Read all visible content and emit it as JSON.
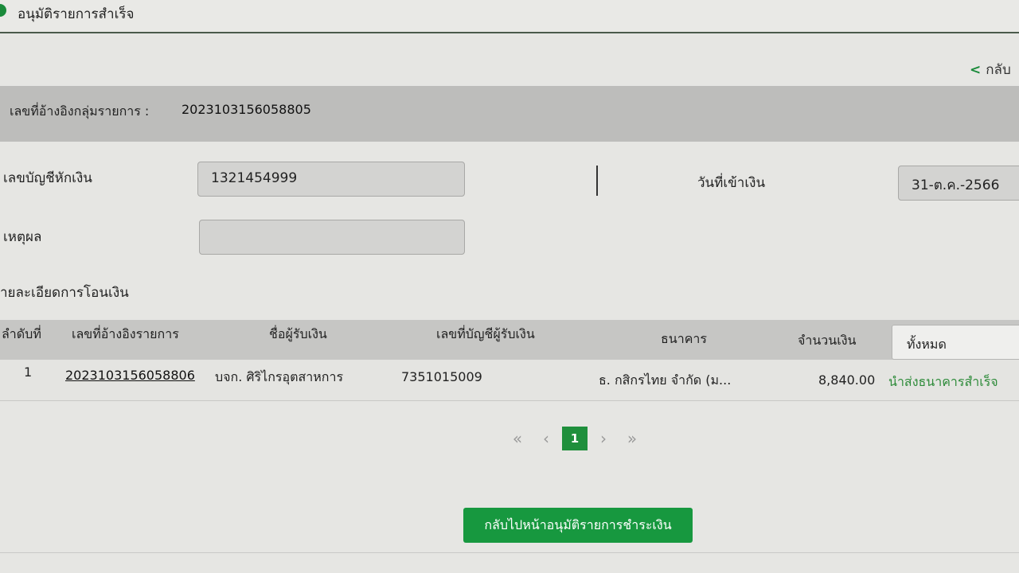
{
  "header": {
    "title": "อนุมัติรายการสำเร็จ"
  },
  "back_link": {
    "label": "กลับ"
  },
  "group_ref": {
    "label": "เลขที่อ้างอิงกลุ่มรายการ :",
    "value": "2023103156058805"
  },
  "form": {
    "debit_account": {
      "label": "เลขบัญชีหักเงิน",
      "value": "1321454999"
    },
    "credit_date": {
      "label": "วันที่เข้าเงิน",
      "value": "31-ต.ค.-2566"
    },
    "reason": {
      "label": "เหตุผล",
      "value": ""
    }
  },
  "section": {
    "title": "ายละเอียดการโอนเงิน"
  },
  "table": {
    "columns": [
      "ลำดับที่",
      "เลขที่อ้างอิงรายการ",
      "ชื่อผู้รับเงิน",
      "เลขที่บัญชีผู้รับเงิน",
      "ธนาคาร",
      "จำนวนเงิน"
    ],
    "filter": "ทั้งหมด",
    "rows": [
      {
        "seq": "1",
        "ref": "2023103156058806",
        "payee": "บจก. ศิริไกรอุตสาหการ",
        "account": "7351015009",
        "bank": "ธ. กสิกรไทย จำกัด (ม...",
        "amount": "8,840.00",
        "status": "นำส่งธนาคารสำเร็จ"
      }
    ]
  },
  "pagination": {
    "first": "«",
    "prev": "‹",
    "current": "1",
    "next": "›",
    "last": "»"
  },
  "footer": {
    "button_label": "กลับไปหน้าอนุมัติรายการชำระเงิน"
  },
  "colors": {
    "accent": "#17983f",
    "status": "#2e8b3a"
  }
}
